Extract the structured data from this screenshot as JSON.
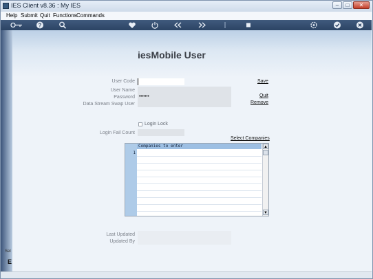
{
  "window": {
    "title": "IES Client v8.36 : My IES",
    "icon": "ies-app-icon"
  },
  "title_controls": {
    "minimize": "–",
    "maximize": "□",
    "close": "✕"
  },
  "menu": [
    "Help",
    "Submit",
    "Quit",
    "Functions",
    "Commands"
  ],
  "toolbar": [
    "key-icon",
    "help-icon",
    "search-icon",
    "heart-icon",
    "power-icon",
    "rewind-icon",
    "fast-forward-icon",
    "bookmark-icon",
    "stop-icon",
    "settings-icon",
    "accept-icon",
    "close-icon"
  ],
  "page": {
    "title": "iesMobile User"
  },
  "form": {
    "user_code": {
      "label": "User Code",
      "value": ""
    },
    "user_name": {
      "label": "User Name",
      "value": ""
    },
    "password": {
      "label": "Password",
      "value": "•••••••"
    },
    "data_stream_swap_user": {
      "label": "Data Stream Swap User",
      "value": ""
    },
    "login_lock": {
      "label": "Login Lock",
      "checked": false
    },
    "login_fail_count": {
      "label": "Login Fail Count",
      "value": ""
    },
    "last_updated": {
      "label": "Last Updated",
      "value": ""
    },
    "updated_by": {
      "label": "Updated By",
      "value": ""
    }
  },
  "actions": {
    "save": "Save",
    "quit": "Quit",
    "remove": "Remove",
    "select_companies": "Select Companies"
  },
  "companies_grid": {
    "header": "Companies to enter",
    "rows": [
      {
        "num": "1",
        "value": ""
      }
    ]
  },
  "scroll": {
    "up": "▲",
    "down": "▼"
  },
  "partial_text": {
    "cut_label": "Sel",
    "cut_glyph": "E"
  }
}
